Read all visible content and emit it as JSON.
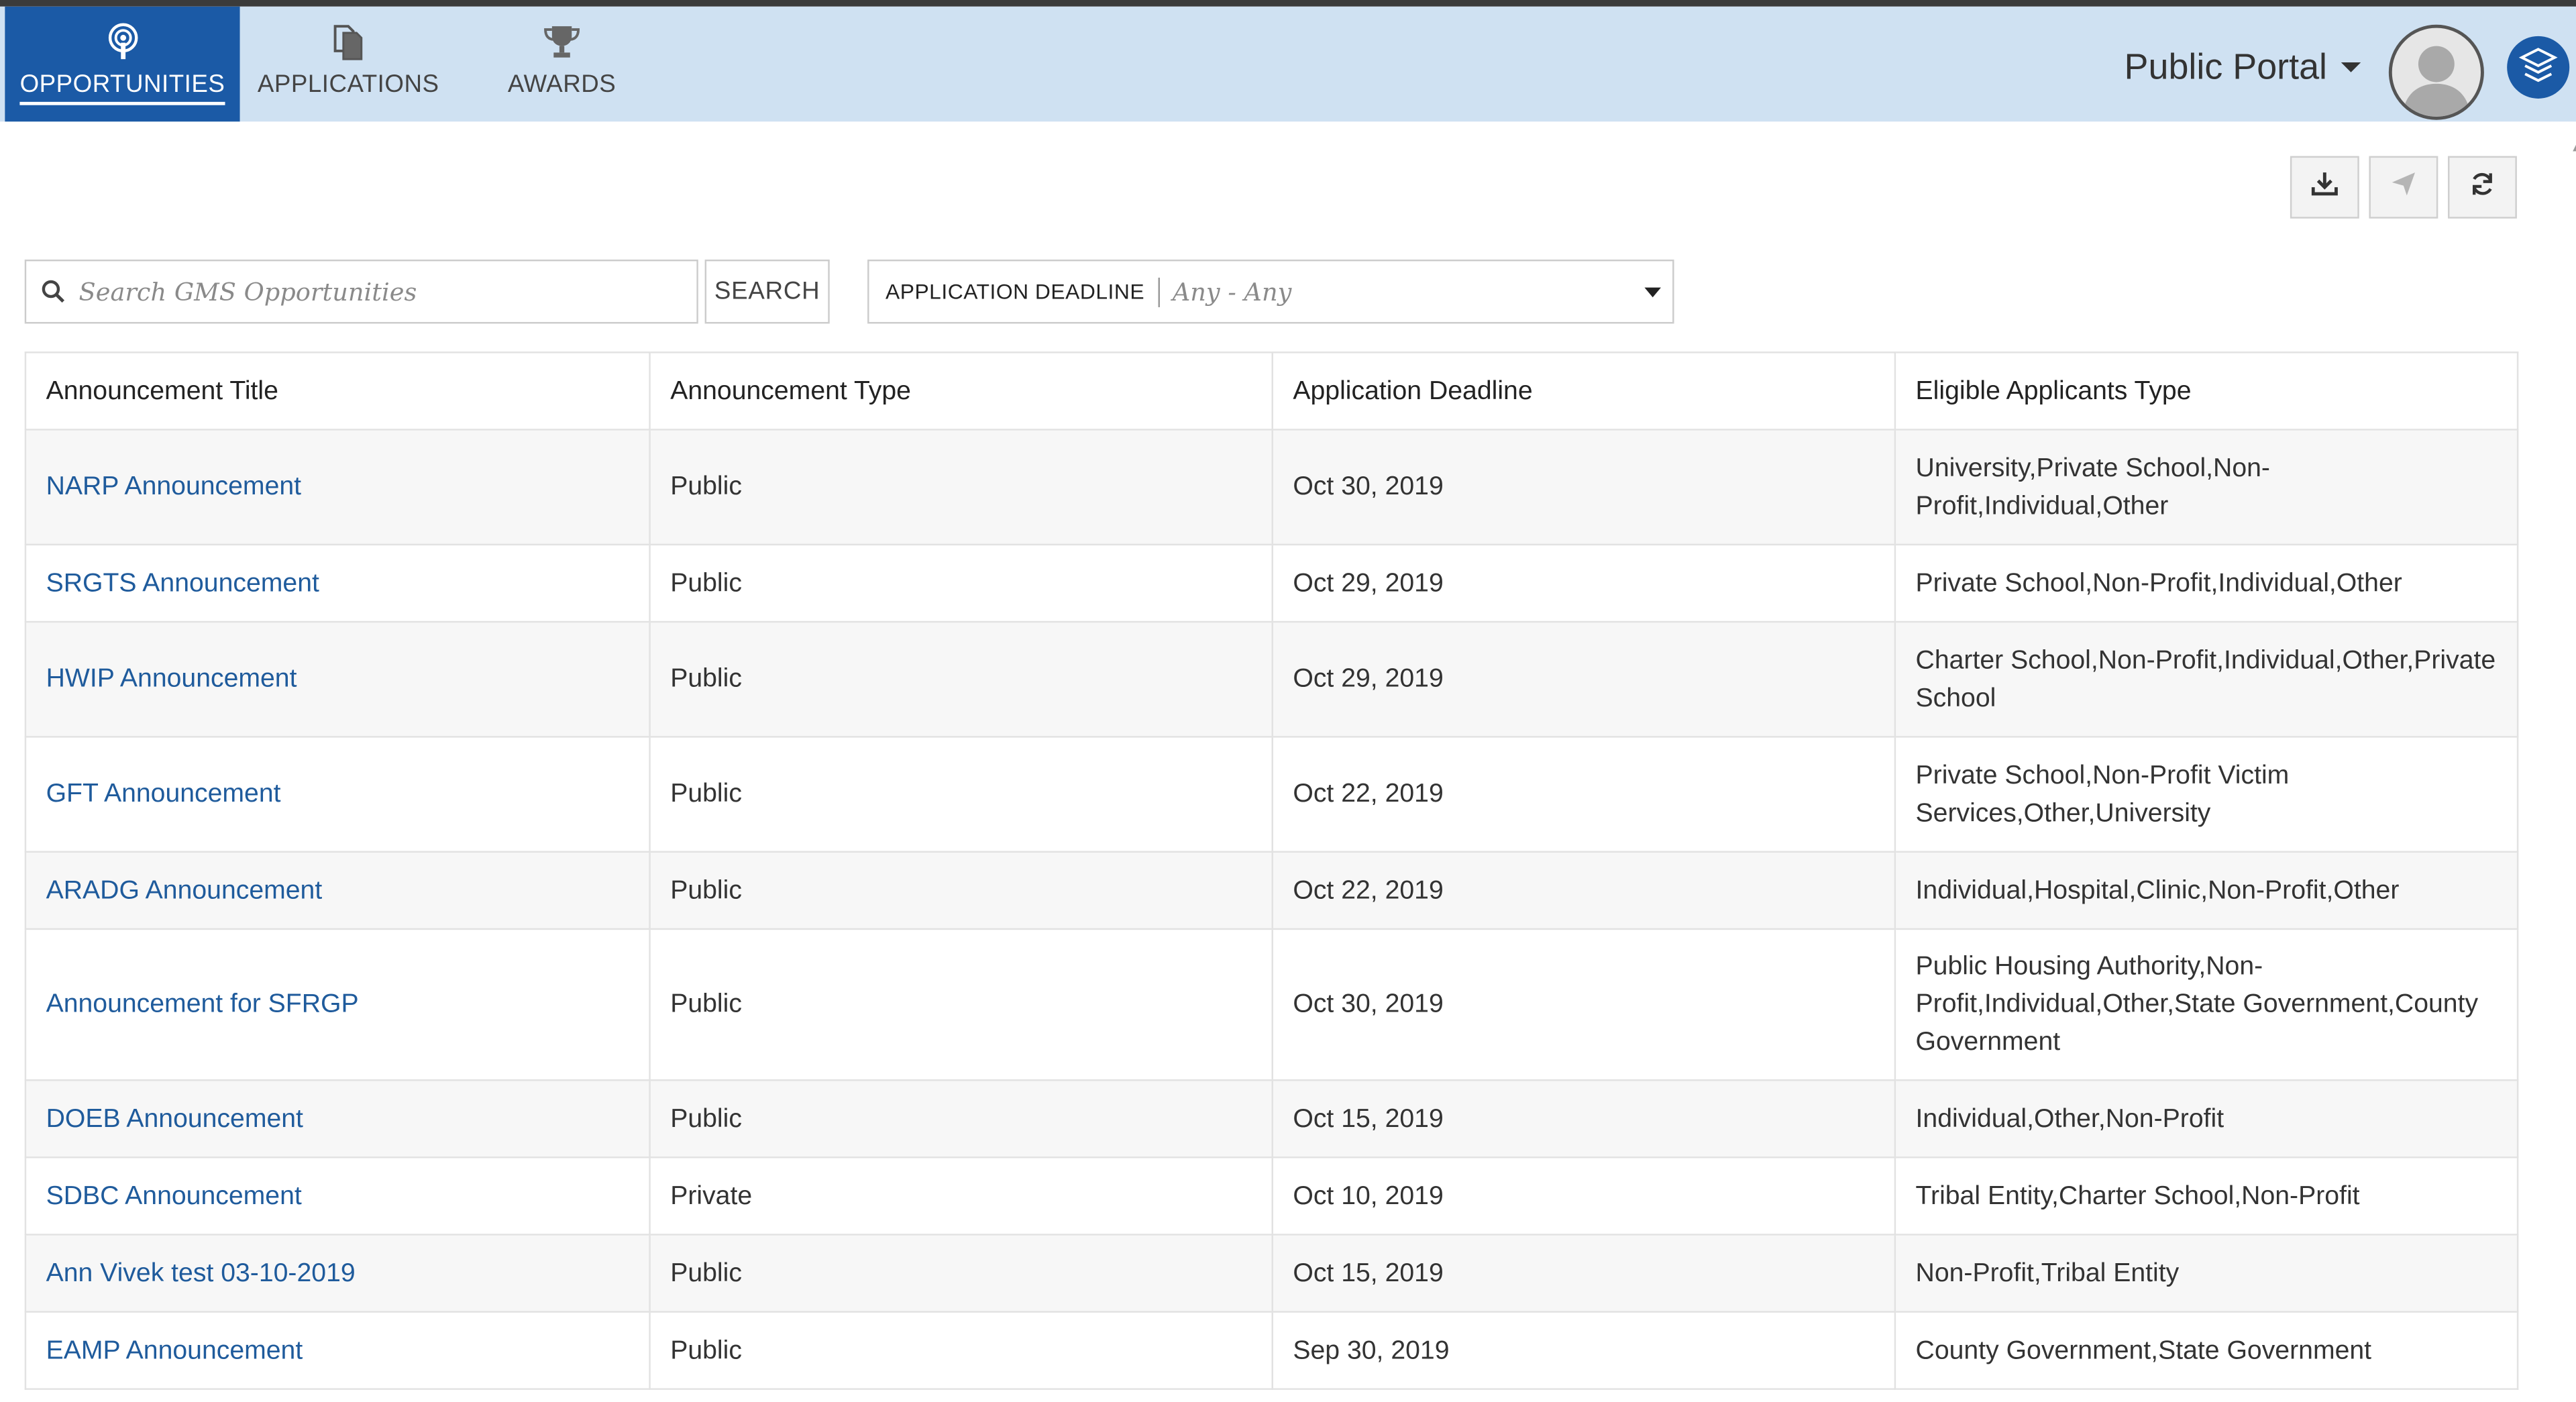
{
  "nav": {
    "tabs": [
      {
        "label": "OPPORTUNITIES",
        "icon": "podcast-icon",
        "active": true
      },
      {
        "label": "APPLICATIONS",
        "icon": "documents-icon",
        "active": false
      },
      {
        "label": "AWARDS",
        "icon": "trophy-icon",
        "active": false
      }
    ],
    "portal_label": "Public Portal"
  },
  "toolbar": {
    "buttons": [
      "download-icon",
      "send-icon",
      "refresh-icon"
    ]
  },
  "search": {
    "placeholder": "Search GMS Opportunities",
    "value": "",
    "button_label": "SEARCH"
  },
  "filter": {
    "label": "APPLICATION DEADLINE",
    "value": "Any - Any"
  },
  "table": {
    "headers": [
      "Announcement Title",
      "Announcement Type",
      "Application Deadline",
      "Eligible Applicants Type"
    ],
    "rows": [
      {
        "title": "NARP Announcement",
        "type": "Public",
        "deadline": "Oct 30, 2019",
        "eligible": "University,Private School,Non-Profit,Individual,Other"
      },
      {
        "title": "SRGTS Announcement",
        "type": "Public",
        "deadline": "Oct 29, 2019",
        "eligible": "Private School,Non-Profit,Individual,Other"
      },
      {
        "title": "HWIP Announcement",
        "type": "Public",
        "deadline": "Oct 29, 2019",
        "eligible": "Charter School,Non-Profit,Individual,Other,Private School"
      },
      {
        "title": "GFT Announcement",
        "type": "Public",
        "deadline": "Oct 22, 2019",
        "eligible": "Private School,Non-Profit Victim Services,Other,University"
      },
      {
        "title": "ARADG Announcement",
        "type": "Public",
        "deadline": "Oct 22, 2019",
        "eligible": "Individual,Hospital,Clinic,Non-Profit,Other"
      },
      {
        "title": "Announcement for SFRGP",
        "type": "Public",
        "deadline": "Oct 30, 2019",
        "eligible": "Public Housing Authority,Non-Profit,Individual,Other,State Government,County Government"
      },
      {
        "title": "DOEB Announcement",
        "type": "Public",
        "deadline": "Oct 15, 2019",
        "eligible": "Individual,Other,Non-Profit"
      },
      {
        "title": "SDBC Announcement",
        "type": "Private",
        "deadline": "Oct 10, 2019",
        "eligible": "Tribal Entity,Charter School,Non-Profit"
      },
      {
        "title": "Ann Vivek test 03-10-2019",
        "type": "Public",
        "deadline": "Oct 15, 2019",
        "eligible": "Non-Profit,Tribal Entity"
      },
      {
        "title": "EAMP Announcement",
        "type": "Public",
        "deadline": "Sep 30, 2019",
        "eligible": "County Government,State Government"
      }
    ]
  },
  "colors": {
    "nav_bg": "#cfe1f2",
    "active_tab": "#1b5aa6",
    "link": "#1f5b9c",
    "row_alt": "#f7f7f7"
  }
}
